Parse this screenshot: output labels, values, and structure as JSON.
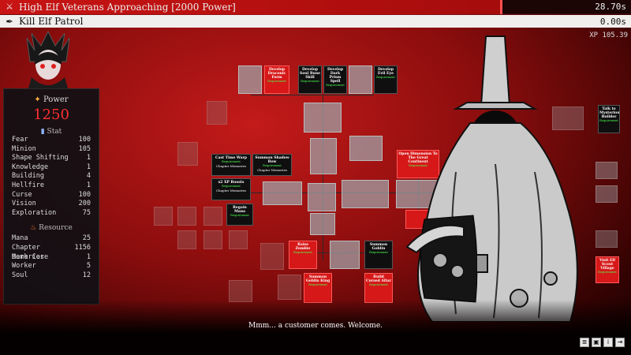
{
  "quest_bar": {
    "title": "High Elf Veterans Approaching [2000 Power]",
    "time": "28.70s",
    "icon": "crossed-swords-icon"
  },
  "task_bar": {
    "title": "Kill Elf Patrol",
    "time": "0.00s",
    "icon": "quill-icon"
  },
  "xp": "XP 105.39",
  "stats_panel": {
    "power_label": "Power",
    "power_value": "1250",
    "stat_label": "Stat",
    "stats": [
      {
        "name": "Fear",
        "value": "100"
      },
      {
        "name": "Minion",
        "value": "105"
      },
      {
        "name": "Shape Shifting",
        "value": "1"
      },
      {
        "name": "Knowledge",
        "value": "1"
      },
      {
        "name": "Building",
        "value": "4"
      },
      {
        "name": "Hellfire",
        "value": "1"
      },
      {
        "name": "Curse",
        "value": "100"
      },
      {
        "name": "Vision",
        "value": "200"
      },
      {
        "name": "Exploration",
        "value": "75"
      }
    ],
    "resource_label": "Resource",
    "resources": [
      {
        "name": "Mana",
        "value": "25"
      },
      {
        "name": "Chapter Memories",
        "value": "1156"
      },
      {
        "name": "Dark Core",
        "value": "1"
      },
      {
        "name": "Worker",
        "value": "5"
      },
      {
        "name": "Soul",
        "value": "12"
      }
    ]
  },
  "tree_nodes": [
    {
      "id": "develop-draconic-form",
      "title": "Develop Draconic Form",
      "style": "red"
    },
    {
      "id": "develop-soul-rune",
      "title": "Develop Soul Rune Skill",
      "style": "black"
    },
    {
      "id": "develop-dark-prism",
      "title": "Develop Dark Prism Spell",
      "style": "black"
    },
    {
      "id": "develop-evil-eye",
      "title": "Develop Evil Eye",
      "style": "black"
    },
    {
      "id": "cast-time-warp",
      "title": "Cast Time Warp",
      "style": "black"
    },
    {
      "id": "summon-shadow-bow",
      "title": "Summon Shadow Bow",
      "style": "black"
    },
    {
      "id": "open-dimension",
      "title": "Open Dimension To The Great Continent",
      "style": "red"
    },
    {
      "id": "xp-boosts",
      "title": "x2 XP Boosts",
      "style": "black"
    },
    {
      "id": "regain-mana",
      "title": "Regain Mana",
      "style": "black"
    },
    {
      "id": "raise-zombie",
      "title": "Raise Zombie",
      "style": "red"
    },
    {
      "id": "summon-goblin",
      "title": "Summon Goblin",
      "style": "black"
    },
    {
      "id": "summon-goblin-king",
      "title": "Summon Goblin King",
      "style": "red"
    },
    {
      "id": "build-cursed-altar",
      "title": "Build Cursed Altar",
      "style": "red"
    },
    {
      "id": "talk-to-mysterious-builder",
      "title": "Talk to Mysterious Builder",
      "style": "black"
    },
    {
      "id": "visit-elf-scout-village",
      "title": "Visit Elf Scout Village",
      "style": "red"
    }
  ],
  "node_requirement_label": "Requirement",
  "node_cost_label": "Chapter Memories",
  "dialogue": "Mmm... a customer comes. Welcome.",
  "buttons": [
    {
      "id": "menu",
      "glyph": "≣"
    },
    {
      "id": "save",
      "glyph": "▣"
    },
    {
      "id": "info",
      "glyph": "i"
    },
    {
      "id": "exit",
      "glyph": "⇥"
    }
  ],
  "colors": {
    "accent": "#d61818",
    "power": "#ff3030",
    "bar": "#c81414"
  }
}
